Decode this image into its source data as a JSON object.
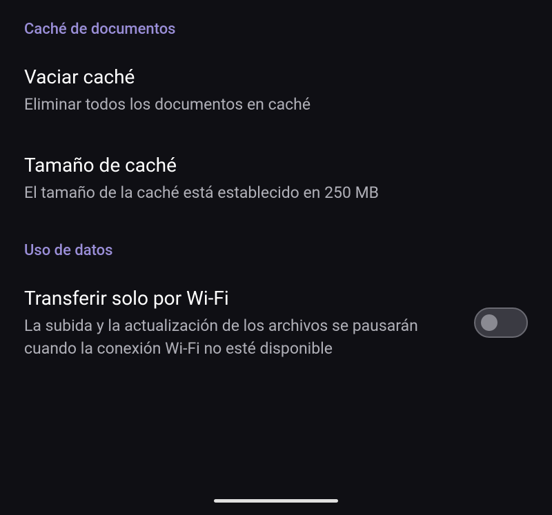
{
  "sections": {
    "cache": {
      "header": "Caché de documentos",
      "items": {
        "clear_cache": {
          "title": "Vaciar caché",
          "description": "Eliminar todos los documentos en caché"
        },
        "cache_size": {
          "title": "Tamaño de caché",
          "description": "El tamaño de la caché está establecido en 250 MB"
        }
      }
    },
    "data_usage": {
      "header": "Uso de datos",
      "items": {
        "wifi_only": {
          "title": "Transferir solo por Wi-Fi",
          "description": "La subida y la actualización de los archivos se pausarán cuando la conexión Wi-Fi no esté disponible",
          "enabled": false
        }
      }
    }
  }
}
